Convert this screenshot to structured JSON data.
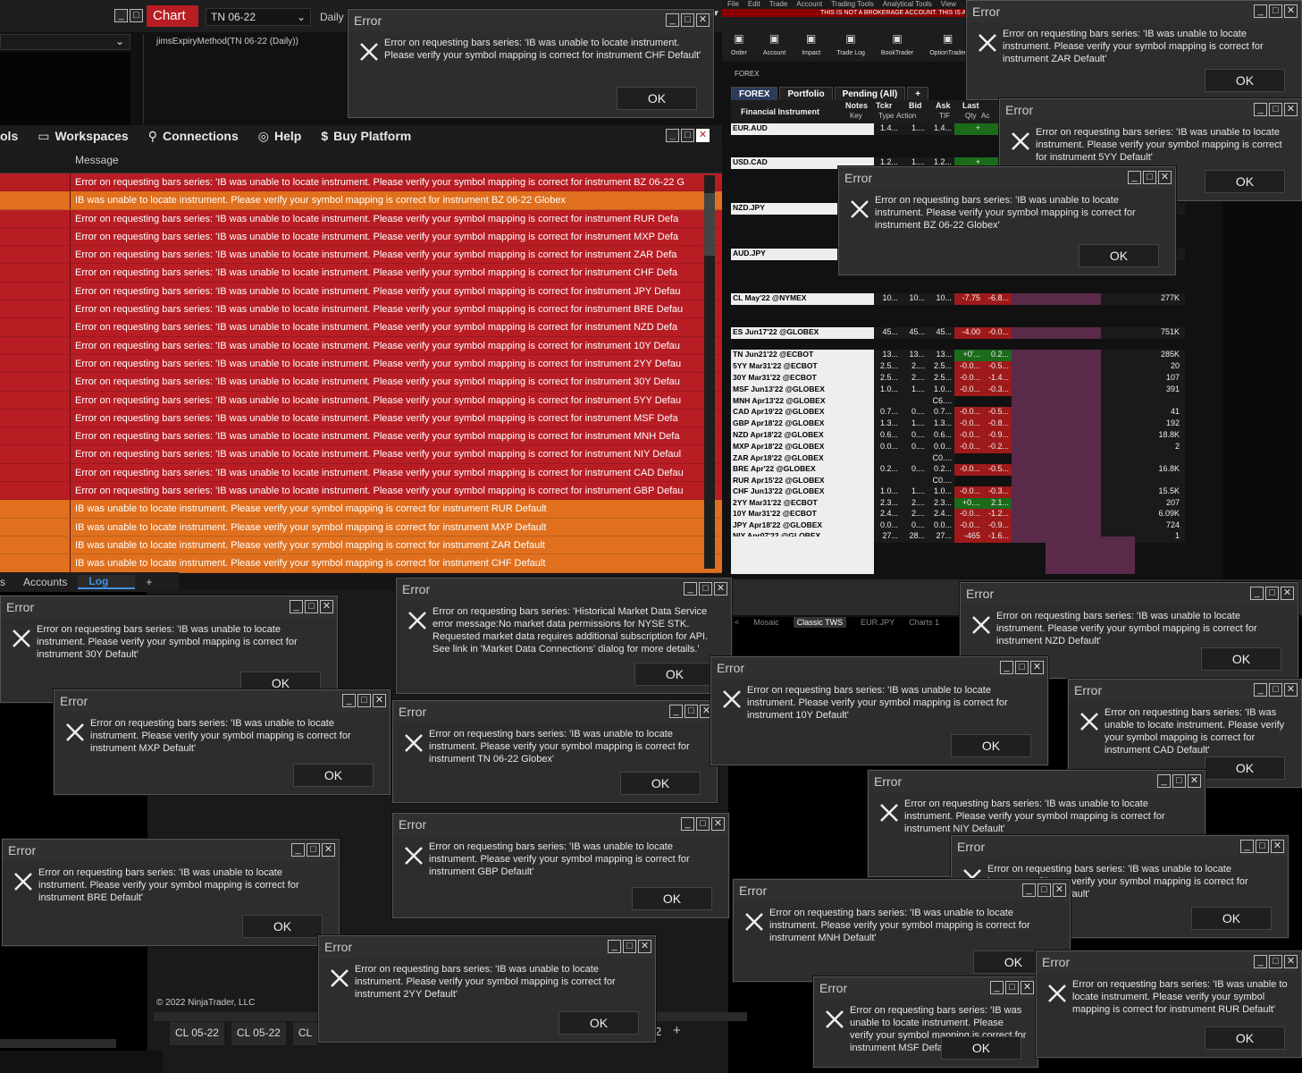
{
  "chart_window": {
    "title": "Chart",
    "instrument": "TN 06-22",
    "period": "Daily",
    "indicator_label": "jimsExpiryMethod(TN 06-22 (Daily))"
  },
  "control_center": {
    "menu": [
      {
        "icon": "workspaces-icon",
        "label": "Workspaces"
      },
      {
        "icon": "connections-icon",
        "label": "Connections"
      },
      {
        "icon": "help-icon",
        "label": "Help"
      },
      {
        "icon": "dollar-icon",
        "label": "Buy Platform"
      }
    ],
    "menu_partial": "ols",
    "column_header": "Message",
    "log_rows": [
      {
        "type": "r",
        "text": "Error on requesting bars series: 'IB was unable to locate instrument. Please verify your symbol mapping is correct for instrument BZ 06-22 G"
      },
      {
        "type": "o",
        "text": "IB was unable to locate instrument. Please verify your symbol mapping is correct for instrument BZ 06-22 Globex"
      },
      {
        "type": "r",
        "text": "Error on requesting bars series: 'IB was unable to locate instrument. Please verify your symbol mapping is correct for instrument RUR Defa"
      },
      {
        "type": "r",
        "text": "Error on requesting bars series: 'IB was unable to locate instrument. Please verify your symbol mapping is correct for instrument MXP Defa"
      },
      {
        "type": "r",
        "text": "Error on requesting bars series: 'IB was unable to locate instrument. Please verify your symbol mapping is correct for instrument ZAR Defa"
      },
      {
        "type": "r",
        "text": "Error on requesting bars series: 'IB was unable to locate instrument. Please verify your symbol mapping is correct for instrument CHF Defa"
      },
      {
        "type": "r",
        "text": "Error on requesting bars series: 'IB was unable to locate instrument. Please verify your symbol mapping is correct for instrument JPY Defau"
      },
      {
        "type": "r",
        "text": "Error on requesting bars series: 'IB was unable to locate instrument. Please verify your symbol mapping is correct for instrument BRE Defau"
      },
      {
        "type": "r",
        "text": "Error on requesting bars series: 'IB was unable to locate instrument. Please verify your symbol mapping is correct for instrument NZD Defa"
      },
      {
        "type": "r",
        "text": "Error on requesting bars series: 'IB was unable to locate instrument. Please verify your symbol mapping is correct for instrument 10Y Defau"
      },
      {
        "type": "r",
        "text": "Error on requesting bars series: 'IB was unable to locate instrument. Please verify your symbol mapping is correct for instrument 2YY Defau"
      },
      {
        "type": "r",
        "text": "Error on requesting bars series: 'IB was unable to locate instrument. Please verify your symbol mapping is correct for instrument 30Y Defau"
      },
      {
        "type": "r",
        "text": "Error on requesting bars series: 'IB was unable to locate instrument. Please verify your symbol mapping is correct for instrument 5YY Defau"
      },
      {
        "type": "r",
        "text": "Error on requesting bars series: 'IB was unable to locate instrument. Please verify your symbol mapping is correct for instrument MSF Defa"
      },
      {
        "type": "r",
        "text": "Error on requesting bars series: 'IB was unable to locate instrument. Please verify your symbol mapping is correct for instrument MNH Defa"
      },
      {
        "type": "r",
        "text": "Error on requesting bars series: 'IB was unable to locate instrument. Please verify your symbol mapping is correct for instrument NIY Defaul"
      },
      {
        "type": "r",
        "text": "Error on requesting bars series: 'IB was unable to locate instrument. Please verify your symbol mapping is correct for instrument CAD Defau"
      },
      {
        "type": "r",
        "text": "Error on requesting bars series: 'IB was unable to locate instrument. Please verify your symbol mapping is correct for instrument GBP Defau"
      },
      {
        "type": "o",
        "text": "IB was unable to locate instrument. Please verify your symbol mapping is correct for instrument RUR Default"
      },
      {
        "type": "o",
        "text": "IB was unable to locate instrument. Please verify your symbol mapping is correct for instrument MXP Default"
      },
      {
        "type": "o",
        "text": "IB was unable to locate instrument. Please verify your symbol mapping is correct for instrument ZAR Default"
      },
      {
        "type": "o",
        "text": "IB was unable to locate instrument. Please verify your symbol mapping is correct for instrument CHF Default"
      }
    ],
    "tabs": [
      "s",
      "Accounts",
      "Log",
      "+"
    ],
    "copyright": "© 2022 NinjaTrader, LLC",
    "bottom_tabs": [
      "CL 05-22",
      "CL 05-22",
      "CL"
    ],
    "bottom_right": [
      "2",
      "+"
    ]
  },
  "tws": {
    "menu": [
      "File",
      "Edit",
      "Trade",
      "Account",
      "Trading Tools",
      "Analytical Tools",
      "View"
    ],
    "banner": "THIS IS NOT A BROKERAGE ACCOUNT. THIS IS A",
    "toolbar": [
      "Order",
      "Account",
      "Impact",
      "Trade Log",
      "BookTrader",
      "OptionTrader"
    ],
    "section": "FOREX",
    "tabs": [
      "FOREX",
      "Portfolio",
      "Pending (All)",
      "+"
    ],
    "col_header": "Financial Instrument",
    "col_sub": [
      "Notes",
      "Tckr",
      "Bid",
      "Ask",
      "Last"
    ],
    "col_sub2": [
      "Key",
      "Type",
      "Action",
      "TIF",
      "Qty",
      "Ac"
    ],
    "bottom_tabs": [
      "<",
      "Mosaic",
      "Classic TWS",
      "EUR.JPY",
      "Charts 1"
    ],
    "rows": [
      {
        "n": "EUR.AUD",
        "b": "1.4...",
        "a": "1....",
        "l": "1.4...",
        "ch": "+",
        "c2": "",
        "v": "",
        "s": "pos"
      },
      {
        "n": "USD.CAD",
        "b": "1.2...",
        "a": "1....",
        "l": "1.2...",
        "ch": "+",
        "c2": "",
        "v": "",
        "s": "pos"
      },
      {
        "n": "NZD.JPY",
        "b": "",
        "a": "",
        "l": "",
        "ch": "",
        "c2": "",
        "v": "",
        "s": ""
      },
      {
        "n": "AUD.JPY",
        "b": "",
        "a": "",
        "l": "",
        "ch": "",
        "c2": "",
        "v": "",
        "s": ""
      },
      {
        "n": "CL May'22 @NYMEX",
        "b": "10...",
        "a": "10...",
        "l": "10...",
        "ch": "-7.75",
        "c2": "-6.8...",
        "v": "277K",
        "s": "neg"
      },
      {
        "n": "ES Jun17'22 @GLOBEX",
        "b": "45...",
        "a": "45...",
        "l": "45...",
        "ch": "-4.00",
        "c2": "-0.0...",
        "v": "751K",
        "s": "neg"
      },
      {
        "n": "TN Jun21'22 @ECBOT",
        "b": "13...",
        "a": "13...",
        "l": "13...",
        "ch": "+0'...",
        "c2": "0.2...",
        "v": "285K",
        "s": "pos"
      },
      {
        "n": "5YY Mar31'22 @ECBOT",
        "b": "2.5...",
        "a": "2....",
        "l": "2.5...",
        "ch": "-0.0...",
        "c2": "-0.5...",
        "v": "20",
        "s": "neg"
      },
      {
        "n": "30Y Mar31'22 @ECBOT",
        "b": "2.5...",
        "a": "2....",
        "l": "2.5...",
        "ch": "-0.0...",
        "c2": "-1.4...",
        "v": "107",
        "s": "neg"
      },
      {
        "n": "MSF Jun13'22 @GLOBEX",
        "b": "1.0...",
        "a": "1....",
        "l": "1.0...",
        "ch": "-0.0...",
        "c2": "-0.3...",
        "v": "391",
        "s": "neg"
      },
      {
        "n": "MNH Apr13'22 @GLOBEX",
        "b": "",
        "a": "",
        "l": "C6....",
        "ch": "",
        "c2": "",
        "v": "",
        "s": ""
      },
      {
        "n": "CAD Apr19'22 @GLOBEX",
        "b": "0.7...",
        "a": "0....",
        "l": "0.7...",
        "ch": "-0.0...",
        "c2": "-0.5...",
        "v": "41",
        "s": "neg"
      },
      {
        "n": "GBP Apr18'22 @GLOBEX",
        "b": "1.3...",
        "a": "1....",
        "l": "1.3...",
        "ch": "-0.0...",
        "c2": "-0.8...",
        "v": "192",
        "s": "neg"
      },
      {
        "n": "NZD Apr18'22 @GLOBEX",
        "b": "0.6...",
        "a": "0....",
        "l": "0.6...",
        "ch": "-0.0...",
        "c2": "-0.9...",
        "v": "18.8K",
        "s": "neg"
      },
      {
        "n": "MXP Apr18'22 @GLOBEX",
        "b": "0.0...",
        "a": "0....",
        "l": "0.0...",
        "ch": "-0.0...",
        "c2": "-0.2...",
        "v": "2",
        "s": "neg"
      },
      {
        "n": "ZAR Apr18'22 @GLOBEX",
        "b": "",
        "a": "",
        "l": "C0....",
        "ch": "",
        "c2": "",
        "v": "",
        "s": ""
      },
      {
        "n": "BRE Apr'22 @GLOBEX",
        "b": "0.2...",
        "a": "0....",
        "l": "0.2...",
        "ch": "-0.0...",
        "c2": "-0.5...",
        "v": "16.8K",
        "s": "neg"
      },
      {
        "n": "RUR Apr15'22 @GLOBEX",
        "b": "",
        "a": "",
        "l": "C0....",
        "ch": "",
        "c2": "",
        "v": "",
        "s": ""
      },
      {
        "n": "CHF Jun13'22 @GLOBEX",
        "b": "1.0...",
        "a": "1....",
        "l": "1.0...",
        "ch": "-0.0...",
        "c2": "-0.3...",
        "v": "15.5K",
        "s": "neg"
      },
      {
        "n": "2YY Mar31'22 @ECBOT",
        "b": "2.3...",
        "a": "2....",
        "l": "2.3...",
        "ch": "+0....",
        "c2": "2.1...",
        "v": "207",
        "s": "pos"
      },
      {
        "n": "10Y Mar31'22 @ECBOT",
        "b": "2.4...",
        "a": "2....",
        "l": "2.4...",
        "ch": "-0.0...",
        "c2": "-1.2...",
        "v": "6.09K",
        "s": "neg"
      },
      {
        "n": "JPY Apr18'22 @GLOBEX",
        "b": "0.0...",
        "a": "0....",
        "l": "0.0...",
        "ch": "-0.0...",
        "c2": "-0.9...",
        "v": "724",
        "s": "neg"
      },
      {
        "n": "NIY Apr07'22 @GLOBEX",
        "b": "27...",
        "a": "28...",
        "l": "27...",
        "ch": "-465",
        "c2": "-1.6...",
        "v": "1",
        "s": "neg"
      }
    ]
  },
  "dialogs": [
    {
      "title": "Error",
      "msg": "Error on requesting bars series: 'IB was unable to locate instrument. Please verify your symbol mapping is correct for instrument CHF Default'",
      "ok": "OK"
    },
    {
      "title": "Error",
      "msg": "Error on requesting bars series: 'IB was unable to locate instrument. Please verify your symbol mapping is correct for instrument ZAR Default'",
      "ok": "OK"
    },
    {
      "title": "Error",
      "msg": "Error on requesting bars series: 'IB was unable to locate instrument. Please verify your symbol mapping is correct for instrument 5YY Default'",
      "ok": "OK"
    },
    {
      "title": "Error",
      "msg": "Error on requesting bars series: 'IB was unable to locate instrument. Please verify your symbol mapping is correct for instrument BZ 06-22 Globex'",
      "ok": "OK"
    },
    {
      "title": "Error",
      "msg": "Error on requesting bars series: 'IB was unable to locate instrument. Please verify your symbol mapping is correct for instrument 30Y Default'",
      "ok": "OK"
    },
    {
      "title": "Error",
      "msg": "Error on requesting bars series: 'Historical Market Data Service error message:No market data permissions for NYSE STK. Requested market data requires additional subscription for API. See link in 'Market Data Connections' dialog for more details.'",
      "ok": "OK"
    },
    {
      "title": "Error",
      "msg": "Error on requesting bars series: 'IB was unable to locate instrument. Please verify your symbol mapping is correct for instrument NZD Default'",
      "ok": "OK"
    },
    {
      "title": "Error",
      "msg": "Error on requesting bars series: 'IB was unable to locate instrument. Please verify your symbol mapping is correct for instrument MXP Default'",
      "ok": "OK"
    },
    {
      "title": "Error",
      "msg": "Error on requesting bars series: 'IB was unable to locate instrument. Please verify your symbol mapping is correct for instrument TN 06-22 Globex'",
      "ok": "OK"
    },
    {
      "title": "Error",
      "msg": "Error on requesting bars series: 'IB was unable to locate instrument. Please verify your symbol mapping is correct for instrument 10Y Default'",
      "ok": "OK"
    },
    {
      "title": "Error",
      "msg": "Error on requesting bars series: 'IB was unable to locate instrument. Please verify your symbol mapping is correct for instrument CAD Default'",
      "ok": "OK"
    },
    {
      "title": "Error",
      "msg": "Error on requesting bars series: 'IB was unable to locate instrument. Please verify your symbol mapping is correct for instrument NIY Default'",
      "ok": "OK"
    },
    {
      "title": "Error",
      "msg": "Error on requesting bars series: 'IB was unable to locate instrument. Please verify your symbol mapping is correct for instrument GBP Default'",
      "ok": "OK"
    },
    {
      "title": "Error",
      "msg": "Error on requesting bars series: 'IB was unable to locate instrument. Please verify your symbol mapping is correct for instrument BRE Default'",
      "ok": "OK"
    },
    {
      "title": "Error",
      "msg": "Error on requesting bars series: 'IB was unable to locate instrument. Please verify your symbol mapping is correct for instrument JPY Default'",
      "ok": "OK"
    },
    {
      "title": "Error",
      "msg": "Error on requesting bars series: 'IB was unable to locate instrument. Please verify your symbol mapping is correct for instrument MNH Default'",
      "ok": "OK"
    },
    {
      "title": "Error",
      "msg": "Error on requesting bars series: 'IB was unable to locate instrument. Please verify your symbol mapping is correct for instrument 2YY Default'",
      "ok": "OK"
    },
    {
      "title": "Error",
      "msg": "Error on requesting bars series: 'IB was unable to locate instrument. Please verify your symbol mapping is correct for instrument MSF Default'",
      "ok": "OK"
    },
    {
      "title": "Error",
      "msg": "Error on requesting bars series: 'IB was unable to locate instrument. Please verify your symbol mapping is correct for instrument RUR Default'",
      "ok": "OK"
    }
  ]
}
